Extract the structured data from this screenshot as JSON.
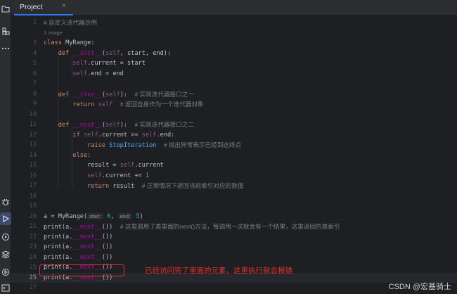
{
  "tab": {
    "label": "Project",
    "close": "×"
  },
  "editor": {
    "lines": [
      {
        "n": "1",
        "type": "comment",
        "text": "# 自定义迭代器示例"
      },
      {
        "n": "",
        "type": "usage",
        "text": "1 usage"
      },
      {
        "n": "3",
        "type": "class",
        "kw": "class",
        "name": "MyRange",
        "rest": ":"
      },
      {
        "n": "4",
        "type": "raw",
        "html_parts": [
          "def",
          "__init__",
          "self",
          "start, end):"
        ]
      },
      {
        "n": "5",
        "type": "selfassign",
        "attr": "current",
        "value": " = start"
      },
      {
        "n": "6",
        "type": "selfassign",
        "attr": "end",
        "value": " = end"
      },
      {
        "n": "7",
        "type": "empty"
      },
      {
        "n": "8",
        "type": "defcomment",
        "name": "__iter__",
        "args": "):",
        "comment": "# 实现迭代器接口之一"
      },
      {
        "n": "9",
        "type": "returnself",
        "comment": "# 返回自身作为一个迭代器对象"
      },
      {
        "n": "10",
        "type": "empty"
      },
      {
        "n": "11",
        "type": "defcomment",
        "name": "__next__",
        "args": "):",
        "comment": "# 实现迭代器接口之二"
      },
      {
        "n": "12",
        "type": "ifline"
      },
      {
        "n": "13",
        "type": "raiseline",
        "exc": "StopIteration",
        "comment": "# 抛出异常表示已经到达终点"
      },
      {
        "n": "14",
        "type": "elseline"
      },
      {
        "n": "15",
        "type": "resultline"
      },
      {
        "n": "16",
        "type": "incline",
        "num": "1"
      },
      {
        "n": "17",
        "type": "returnresult",
        "comment": "# 正常情况下返回当前索引对应的数值"
      },
      {
        "n": "18",
        "type": "empty"
      },
      {
        "n": "19",
        "type": "empty"
      },
      {
        "n": "20",
        "type": "assignline",
        "hint_start": "start:",
        "start": "0",
        "hint_end": "end:",
        "end": "5"
      },
      {
        "n": "21",
        "type": "printnext",
        "comment": "# 这里调用了类里面的next()方法，每调用一次就会有一个结果，这里返回的是索引"
      },
      {
        "n": "22",
        "type": "printnext"
      },
      {
        "n": "23",
        "type": "printnext"
      },
      {
        "n": "24",
        "type": "printnext"
      },
      {
        "n": "25",
        "type": "printnext"
      },
      {
        "n": "25",
        "type": "printnext",
        "current": true
      },
      {
        "n": "27",
        "type": "empty"
      }
    ],
    "tokens": {
      "def": "def",
      "self": "self",
      "return": "return",
      "if": "if",
      "else": "else:",
      "raise": "raise",
      "print": "print",
      "a": "a",
      "next": "__next__",
      "class_call": "MyRange"
    }
  },
  "annotation": {
    "text": "已经访问完了里面的元素，这里执行就会报错"
  },
  "watermark": {
    "text": "CSDN @宏基骑士"
  },
  "colors": {
    "accent": "#3574f0",
    "annotation": "#e8312d",
    "background": "#1e1f22"
  },
  "activity_icons": [
    "folder-icon",
    "structure-icon",
    "more-icon",
    "debug-icon",
    "run-icon",
    "services-icon",
    "layers-icon",
    "play-circle-icon",
    "terminal-icon",
    "problems-icon"
  ]
}
